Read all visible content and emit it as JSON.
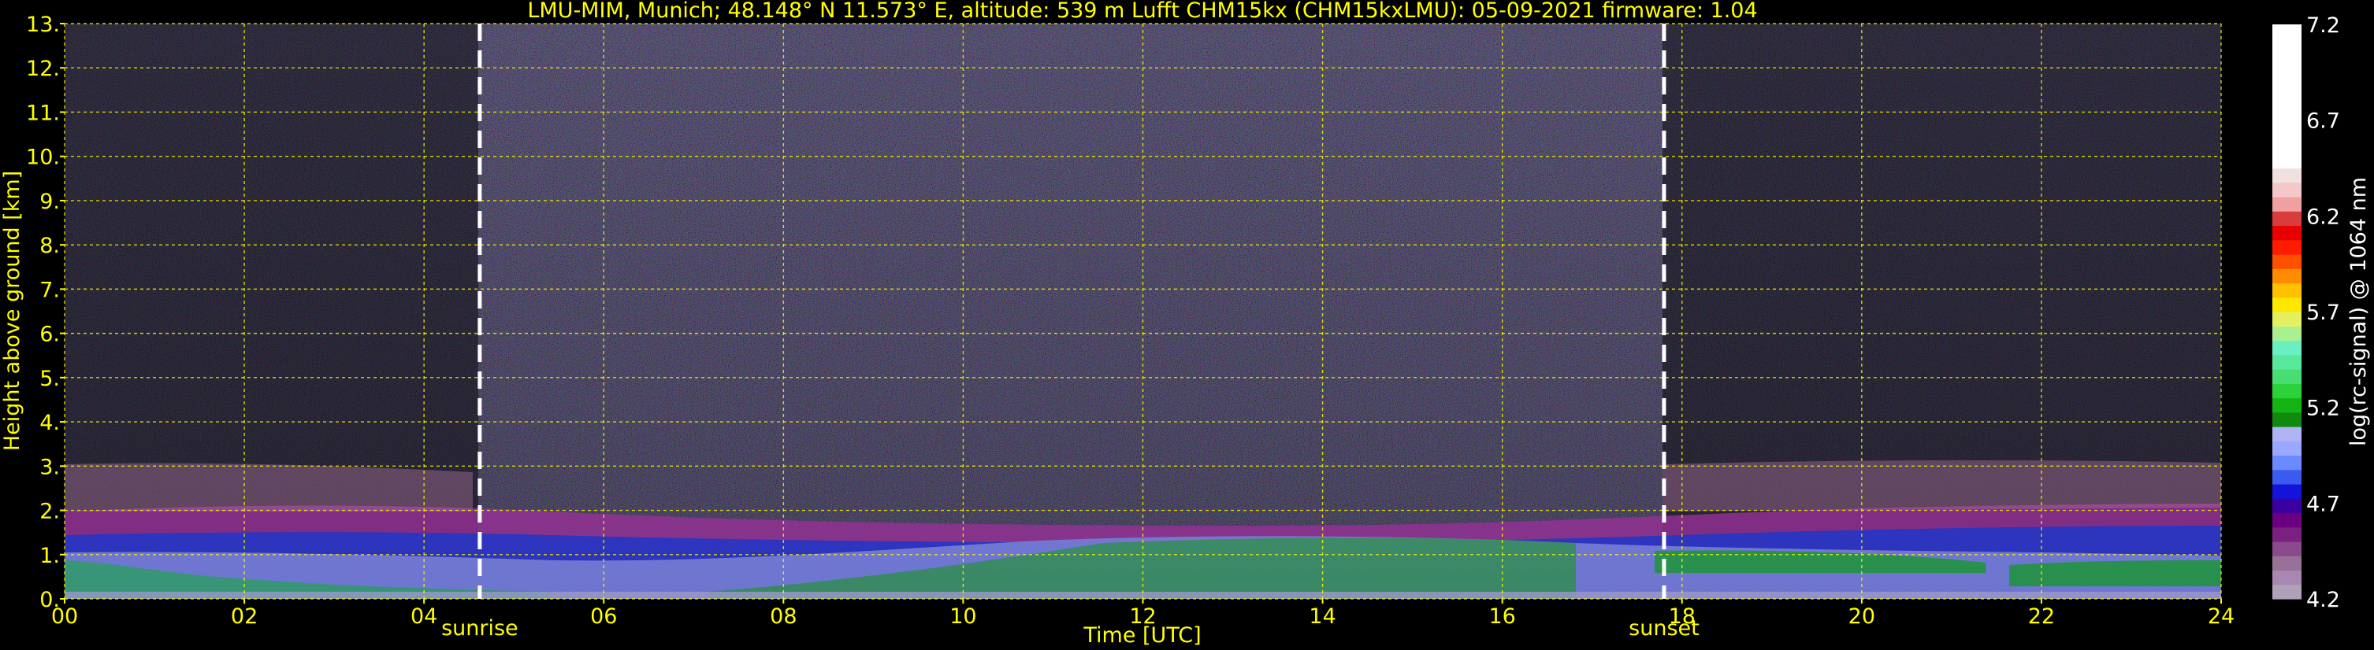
{
  "chart_data": {
    "type": "heatmap",
    "title": "LMU-MIM, Munich; 48.148° N 11.573° E, altitude: 539 m    Lufft CHM15kx (CHM15kxLMU): 05-09-2021    firmware: 1.04",
    "xlabel": "Time [UTC]",
    "ylabel": "Height above ground [km]",
    "xlim": [
      0,
      24
    ],
    "ylim": [
      0,
      13
    ],
    "x_ticks": [
      0,
      2,
      4,
      6,
      8,
      10,
      12,
      14,
      16,
      18,
      20,
      22,
      24
    ],
    "x_tick_labels": [
      "00",
      "02",
      "04",
      "06",
      "08",
      "10",
      "12",
      "14",
      "16",
      "18",
      "20",
      "22",
      "24"
    ],
    "y_ticks": [
      0,
      1,
      2,
      3,
      4,
      5,
      6,
      7,
      8,
      9,
      10,
      11,
      12,
      13
    ],
    "y_tick_labels": [
      "0.",
      "1.",
      "2.",
      "3.",
      "4.",
      "5.",
      "6.",
      "7.",
      "8.",
      "9.",
      "10.",
      "11.",
      "12.",
      "13."
    ],
    "grid": true,
    "markers": [
      {
        "label": "sunrise",
        "time": 4.62
      },
      {
        "label": "sunset",
        "time": 17.8
      }
    ],
    "colorbar": {
      "label": "log(rc-signal) @ 1064 nm",
      "range": [
        4.2,
        7.2
      ],
      "tick_values": [
        4.2,
        4.7,
        5.2,
        5.7,
        6.2,
        6.7,
        7.2
      ],
      "tick_labels": [
        "4.2",
        "4.7",
        "5.2",
        "5.7",
        "6.2",
        "6.7",
        "7.2"
      ],
      "colors": [
        "#b0a0b8",
        "#a888b0",
        "#987098",
        "#8a4a8c",
        "#7a2080",
        "#6a0080",
        "#3c00a0",
        "#1414d8",
        "#3a5af0",
        "#6a8aff",
        "#9aa8ff",
        "#b0b4f4",
        "#0f8a0f",
        "#14b414",
        "#2cd23c",
        "#4ade72",
        "#58e89c",
        "#6af0c0",
        "#a8f090",
        "#e4f060",
        "#ffe800",
        "#ffc000",
        "#ff8c00",
        "#ff5000",
        "#ff1c00",
        "#e80000",
        "#d83c3c",
        "#f0a0a0",
        "#f4c8c8",
        "#f0e0e0",
        "#ffffff"
      ]
    }
  },
  "colors": {
    "text": "#ffff00",
    "grid": "#ffff00",
    "background": "#000000",
    "sky_noise": "#2a1e44",
    "aerosol_layer": "#b038b0",
    "boundary_layer": "#8890f8"
  }
}
